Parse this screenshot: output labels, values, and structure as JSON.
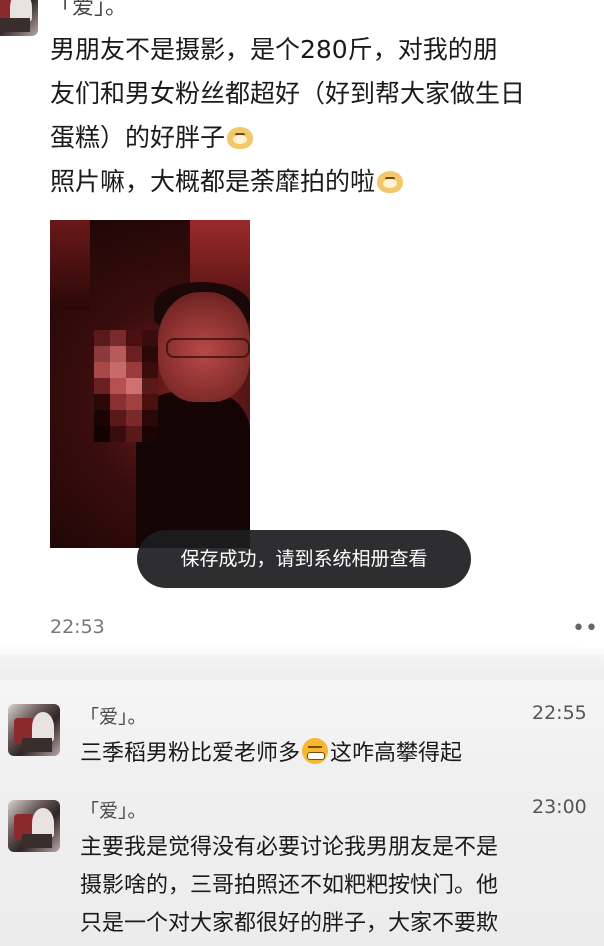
{
  "top_message": {
    "sender_fragment": "「爱」。",
    "lines": [
      "男朋友不是摄影，是个280斤，对我的朋",
      "友们和男女粉丝都超好（好到帮大家做生日",
      "蛋糕）的好胖子",
      "照片嘛，大概都是荼靡拍的啦"
    ],
    "line3_emoji": "doge-cat-emoji",
    "line4_emoji": "doge-cat-emoji"
  },
  "toast": {
    "text": "保存成功，请到系统相册查看"
  },
  "timestamp_1": "22:53",
  "more_label": "••",
  "messages": [
    {
      "sender": "「爱」。",
      "time": "22:55",
      "lines": [
        "三季稻男粉比爱老师多",
        "这咋高攀得起"
      ],
      "emoji": "grimace-emoji"
    },
    {
      "sender": "「爱」。",
      "time": "23:00",
      "lines": [
        "主要我是觉得没有必要讨论我男朋友是不是",
        "摄影啥的，三哥拍照还不如粑粑按快门。他",
        "只是一个对大家都很好的胖子，大家不要欺"
      ]
    }
  ],
  "colors": {
    "toast_bg": "#1c1c1e",
    "photo_tint": "#7a2020",
    "gray_text": "#777777"
  }
}
